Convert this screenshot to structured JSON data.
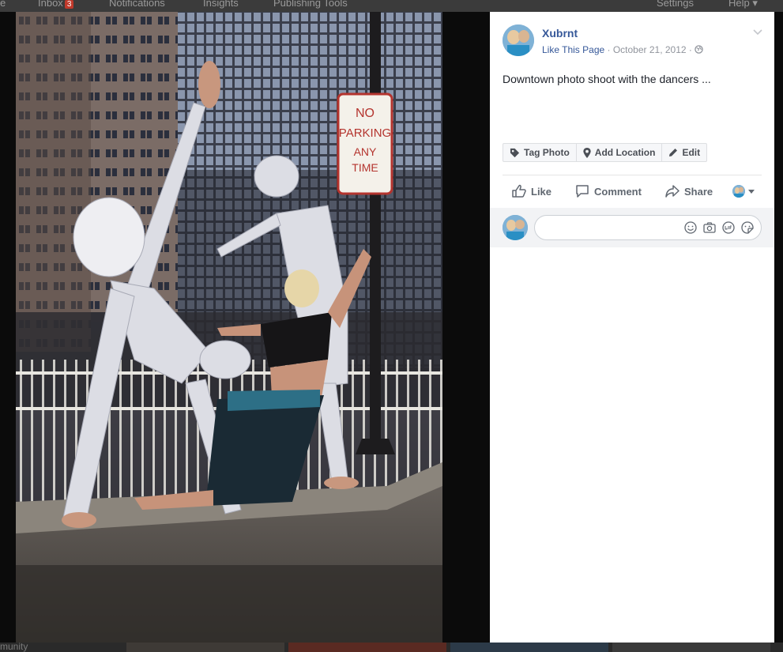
{
  "topbar": {
    "items": [
      "e",
      "Inbox",
      "Notifications",
      "Insights",
      "Publishing Tools",
      "Settings",
      "Help ▾"
    ],
    "inbox_badge": "3"
  },
  "bottombar": {
    "text": "munity"
  },
  "photo": {
    "sign_lines": [
      "NO",
      "PARKING",
      "ANY",
      "TIME"
    ]
  },
  "post": {
    "page_name": "Xubrnt",
    "like_link": "Like This Page",
    "separator": " · ",
    "date": "October 21, 2012",
    "separator2": " · ",
    "text": "Downtown photo shoot with the dancers ...",
    "tag_buttons": [
      "Tag Photo",
      "Add Location",
      "Edit"
    ],
    "actions": {
      "like": "Like",
      "comment": "Comment",
      "share": "Share"
    }
  },
  "icons": {
    "globe": "globe-icon",
    "chevron": "chevron-down-icon",
    "tag": "tag-icon",
    "location": "location-pin-icon",
    "edit": "pencil-icon",
    "like": "thumbs-up-icon",
    "comment": "comment-bubble-icon",
    "share": "share-arrow-icon",
    "emoji": "smiley-icon",
    "camera": "camera-icon",
    "gif": "gif-icon",
    "sticker": "sticker-icon"
  },
  "colors": {
    "link": "#365899",
    "meta": "#90949c",
    "action": "#606770",
    "badge": "#c0392b"
  }
}
